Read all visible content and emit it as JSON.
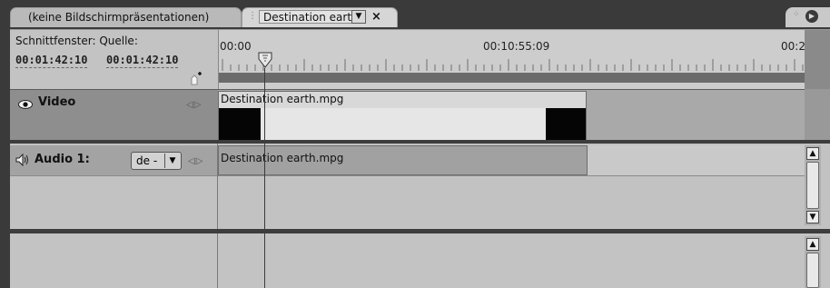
{
  "tabs": {
    "inactive_label": "(keine Bildschirmpräsentationen)",
    "active_label": "Destination earth",
    "close_glyph": "×"
  },
  "header": {
    "sequence_label": "Schnittfenster:",
    "source_label": "Quelle:",
    "sequence_timecode": "00:01:42:10",
    "source_timecode": "00:01:42:10"
  },
  "ruler": {
    "time_start": "00:00",
    "time_mid": "00:10:55:09",
    "time_end": "00:2",
    "playhead_timecode": "00:01:42:10"
  },
  "tracks": {
    "video": {
      "name": "Video",
      "clip_name": "Destination earth.mpg",
      "icon": "eye-icon"
    },
    "audio": {
      "name": "Audio 1:",
      "clip_name": "Destination earth.mpg",
      "language_value": "de -",
      "icon": "speaker-icon"
    }
  },
  "colors": {
    "tab_bar": "#3a3a3a",
    "panel": "#c3c3c3",
    "clip_black": "#050505"
  }
}
